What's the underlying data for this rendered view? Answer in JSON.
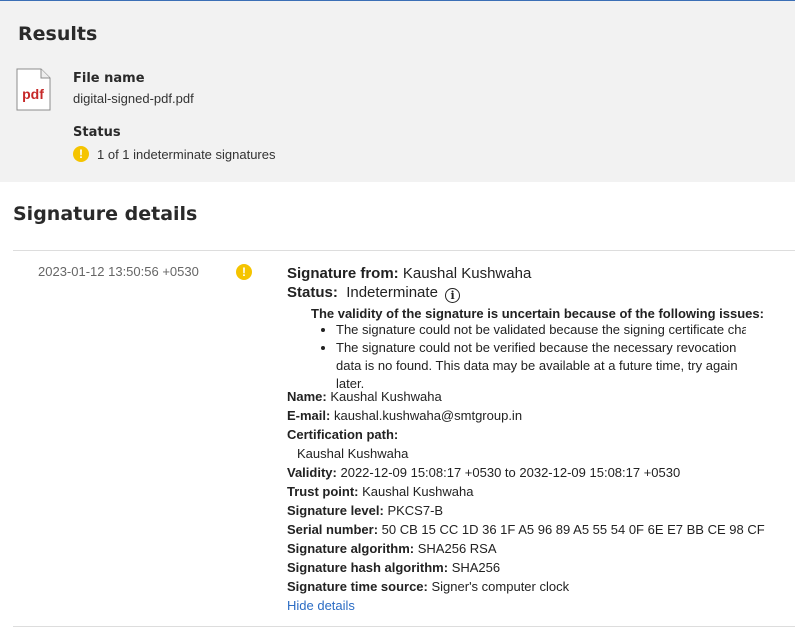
{
  "results": {
    "title": "Results",
    "file_icon_text": "pdf",
    "file_name_label": "File name",
    "file_name": "digital-signed-pdf.pdf",
    "status_label": "Status",
    "status_icon": "warning-icon",
    "status_text": "1 of 1 indeterminate signatures"
  },
  "details": {
    "title": "Signature details",
    "signature": {
      "date": "2023-01-12 13:50:56 +0530",
      "warning_icon": "warning-icon",
      "from_label": "Signature from:",
      "from_value": "Kaushal Kushwaha",
      "status_label": "Status:",
      "status_value": "Indeterminate",
      "info_icon": "info-icon",
      "issues_title": "The validity of the signature is uncertain because of the following issues:",
      "issues": [
        "The signature could not be validated because the signing certificate chain is no",
        "The signature could not be verified because the necessary revocation data is no found. This data may be available at a future time, try again later."
      ],
      "name_label": "Name:",
      "name_value": "Kaushal Kushwaha",
      "email_label": "E-mail:",
      "email_value": "kaushal.kushwaha@smtgroup.in",
      "cert_path_label": "Certification path:",
      "cert_path_value": "Kaushal Kushwaha",
      "validity_label": "Validity:",
      "validity_value": "2022-12-09 15:08:17 +0530 to 2032-12-09 15:08:17 +0530",
      "trust_point_label": "Trust point:",
      "trust_point_value": "Kaushal Kushwaha",
      "sig_level_label": "Signature level:",
      "sig_level_value": "PKCS7-B",
      "serial_label": "Serial number:",
      "serial_value": "50 CB 15 CC 1D 36 1F A5 96 89 A5 55 54 0F 6E E7 BB CE 98 CF",
      "sig_alg_label": "Signature algorithm:",
      "sig_alg_value": "SHA256 RSA",
      "hash_alg_label": "Signature hash algorithm:",
      "hash_alg_value": "SHA256",
      "time_source_label": "Signature time source:",
      "time_source_value": "Signer's computer clock",
      "hide_details": "Hide details"
    }
  },
  "colors": {
    "accent": "#2b6cc4",
    "warning": "#f5c400",
    "pdf_red": "#c62828",
    "panel_bg": "#f2f2f2"
  }
}
